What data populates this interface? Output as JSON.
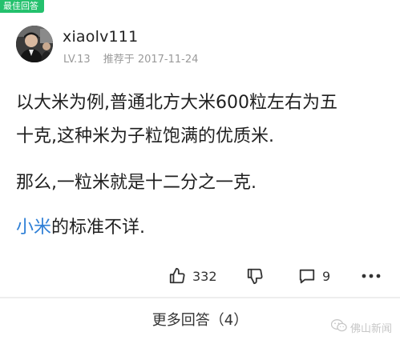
{
  "badge": {
    "label": "最佳回答"
  },
  "author": {
    "name": "xiaolv111",
    "level": "LV.13",
    "recommended": "推荐于 2017-11-24"
  },
  "answer": {
    "line1": "以大米为例,普通北方大米600粒左右为五",
    "line2": "十克,这种米为子粒饱满的优质米.",
    "line3": "那么,一粒米就是十二分之一克.",
    "line4_link": "小米",
    "line4_rest": "的标准不详."
  },
  "actions": {
    "like_count": "332",
    "comment_count": "9",
    "like_icon": "thumbs-up-icon",
    "dislike_icon": "thumbs-down-icon",
    "comment_icon": "comment-icon",
    "more_icon": "more-dots-icon"
  },
  "footer": {
    "more_answers": "更多回答（4）"
  },
  "watermark": {
    "text": "佛山新闻"
  },
  "colors": {
    "badge": "#24c16d",
    "link": "#2e7fd6",
    "meta": "#9a9a9a"
  }
}
